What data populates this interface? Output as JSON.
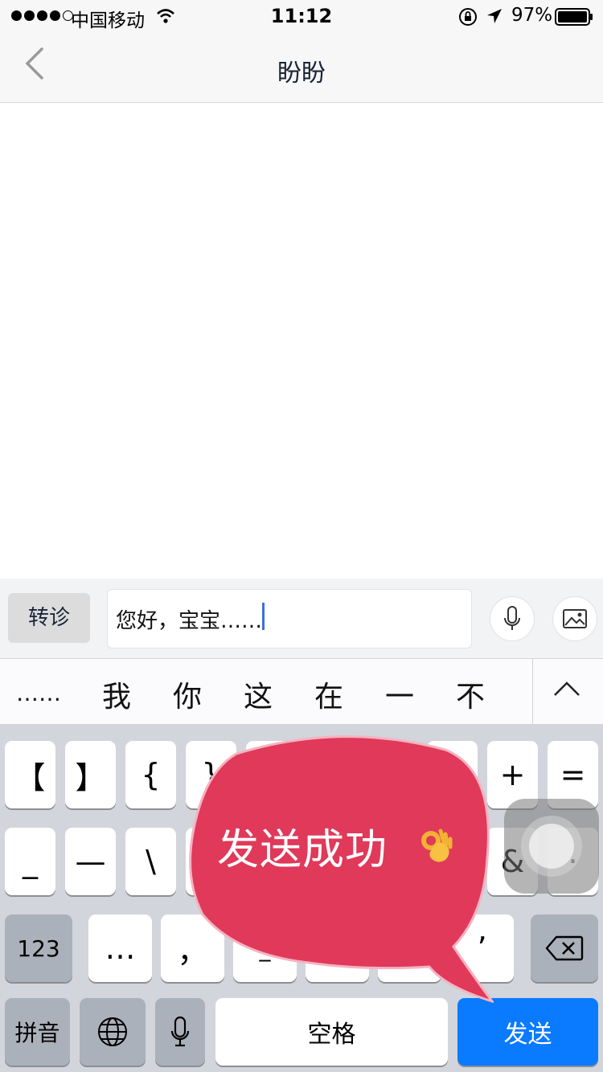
{
  "status_bar": {
    "carrier": "中国移动",
    "time": "11:12",
    "battery": "97%",
    "signal_strength": 4,
    "signal_max": 5
  },
  "nav": {
    "title": "盼盼"
  },
  "composer": {
    "transfer_label": "转诊",
    "input_value": "您好，宝宝……"
  },
  "candidates": {
    "items": [
      "……",
      "我",
      "你",
      "这",
      "在",
      "一",
      "不"
    ]
  },
  "keyboard": {
    "row1": [
      "【",
      "】",
      "{",
      "}",
      "#",
      "%",
      "^",
      "*",
      "+",
      "="
    ],
    "row2": [
      "_",
      "—",
      "\\",
      "|",
      "~",
      "《",
      "》",
      "$",
      "&",
      "·"
    ],
    "row3": [
      "…",
      "，",
      "^_^",
      "？",
      "！",
      "’"
    ],
    "num_label": "123",
    "pinyin_label": "拼音",
    "space_label": "空格",
    "send_label": "发送"
  },
  "toast": {
    "text": "发送成功",
    "color": "#e0395a"
  },
  "colors": {
    "accent": "#0a7aff",
    "nav_title": "#1a2537"
  }
}
